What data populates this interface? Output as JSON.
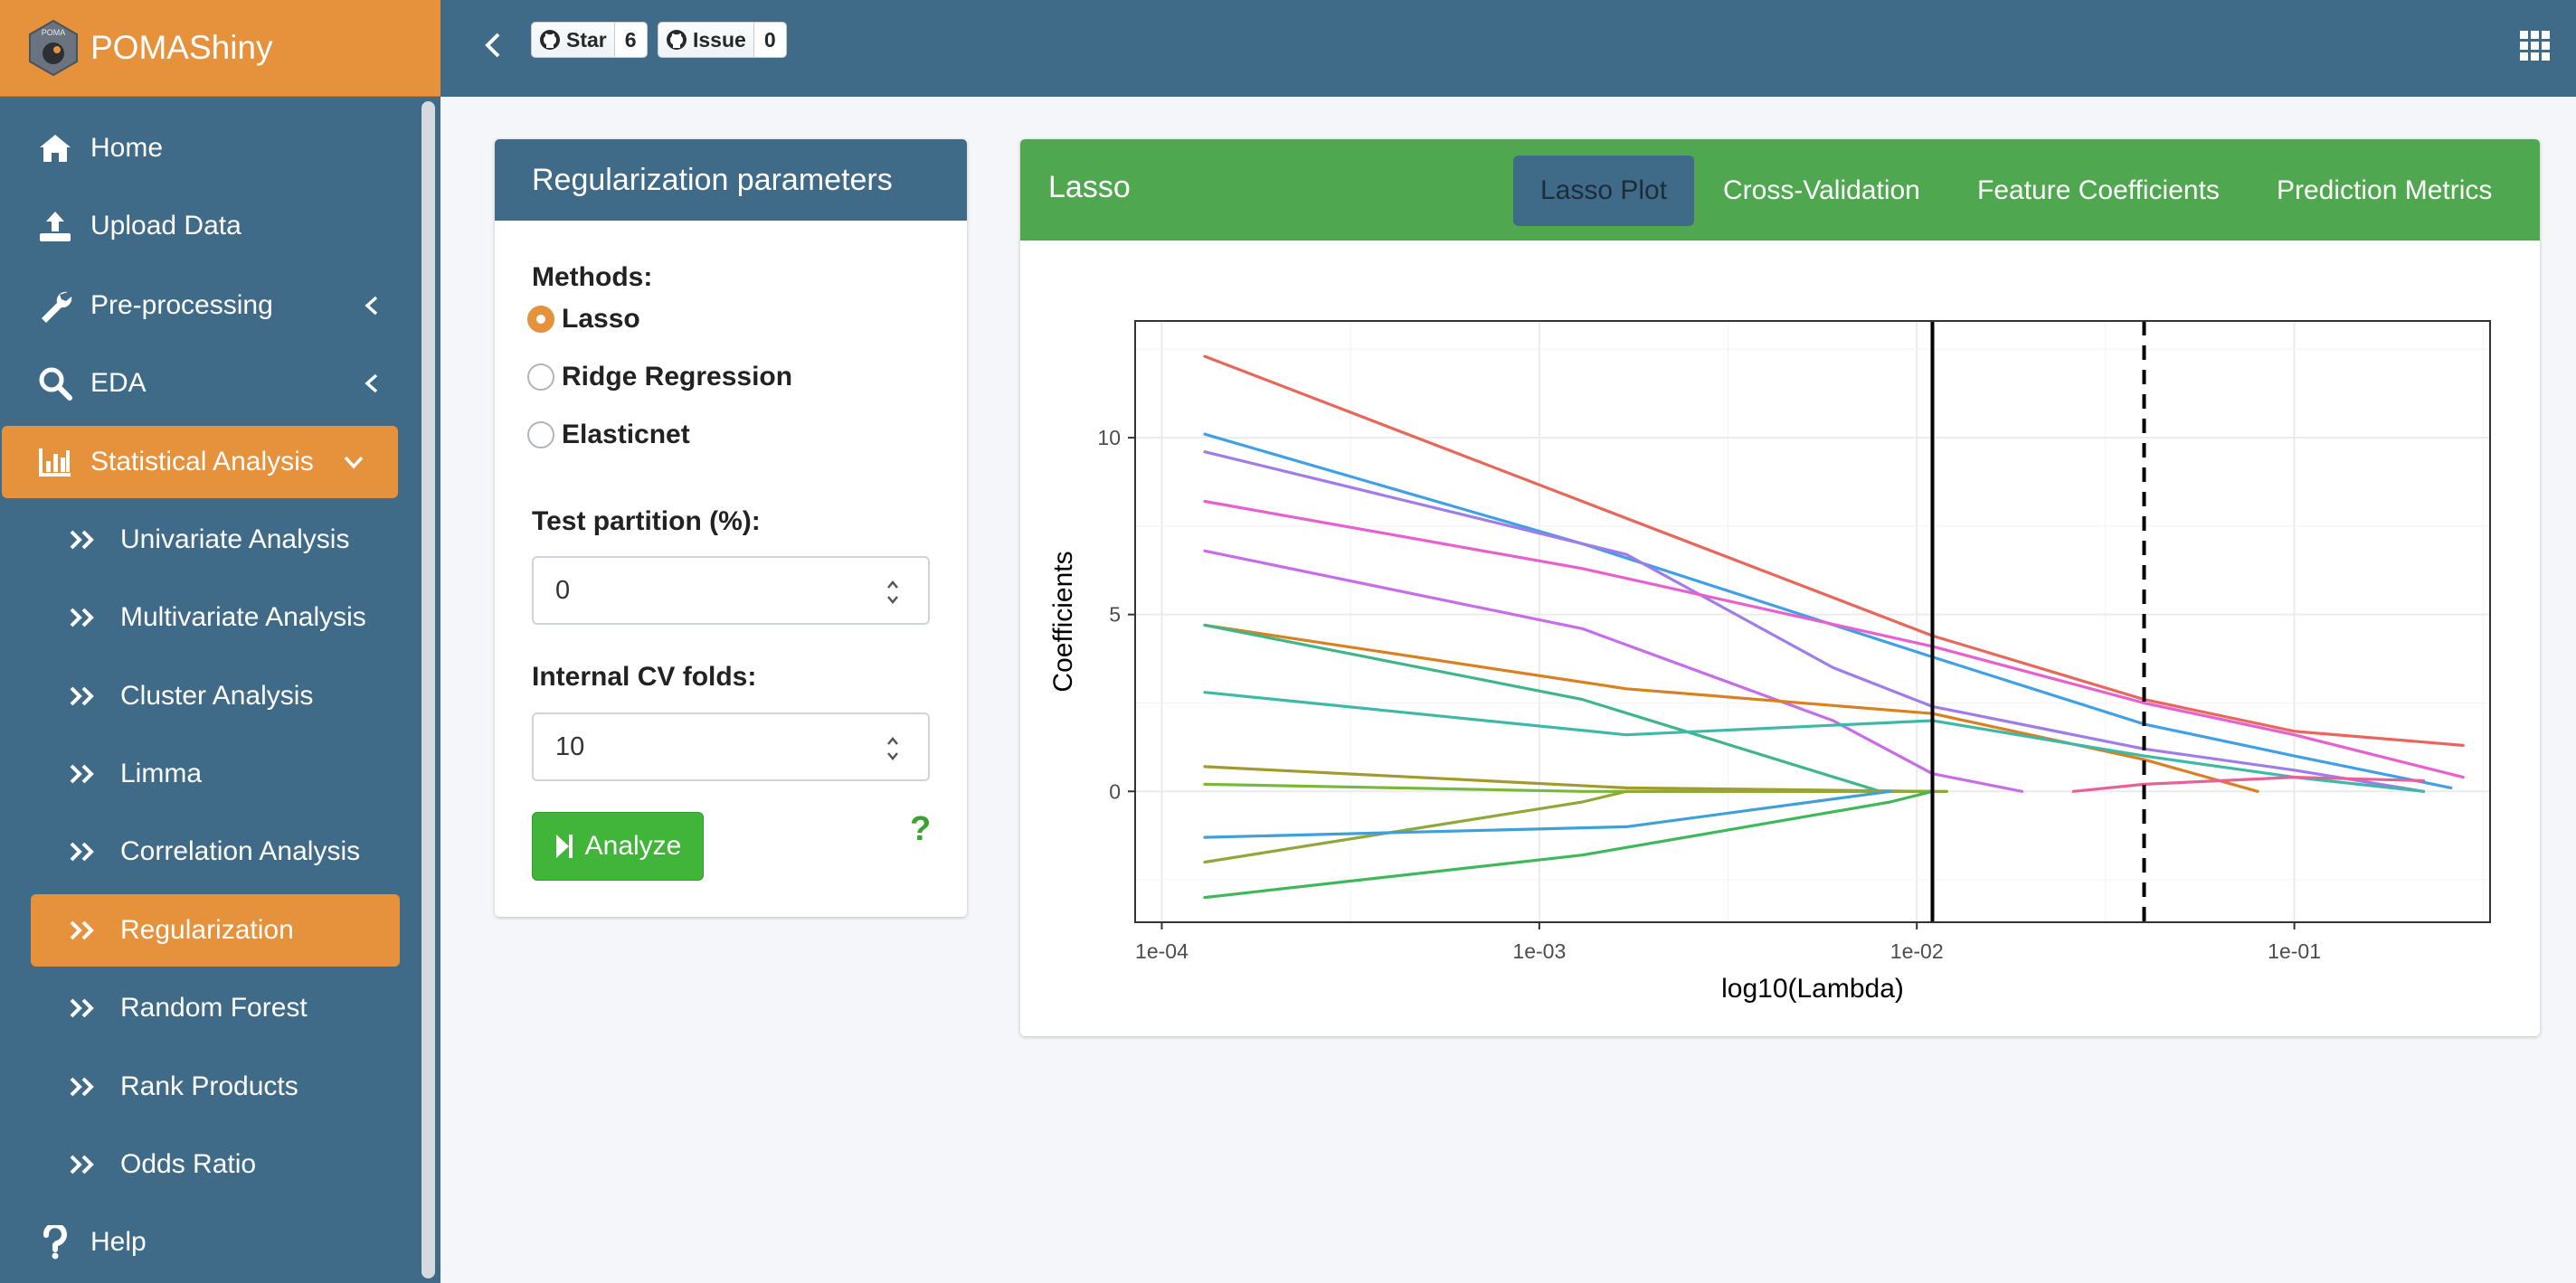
{
  "app": {
    "name": "POMAShiny",
    "logo_text": "POMA",
    "accent_color": "#e6913c",
    "primary_color": "#3f6b88"
  },
  "sidebar": {
    "items": [
      {
        "label": "Home",
        "icon": "home-icon"
      },
      {
        "label": "Upload Data",
        "icon": "upload-icon"
      },
      {
        "label": "Pre-processing",
        "icon": "wrench-icon"
      },
      {
        "label": "EDA",
        "icon": "search-icon"
      },
      {
        "label": "Statistical Analysis",
        "icon": "bar-chart-icon"
      }
    ],
    "sub_items": [
      {
        "label": "Univariate Analysis"
      },
      {
        "label": "Multivariate Analysis"
      },
      {
        "label": "Cluster Analysis"
      },
      {
        "label": "Limma"
      },
      {
        "label": "Correlation Analysis"
      },
      {
        "label": "Regularization"
      },
      {
        "label": "Random Forest"
      },
      {
        "label": "Rank Products"
      },
      {
        "label": "Odds Ratio"
      }
    ],
    "help_label": "Help",
    "active_sub_item": "Regularization"
  },
  "header": {
    "star_label": "Star",
    "star_count": "6",
    "issue_label": "Issue",
    "issue_count": "0"
  },
  "params_panel": {
    "title": "Regularization parameters",
    "methods_label": "Methods:",
    "methods": [
      {
        "label": "Lasso",
        "checked": true
      },
      {
        "label": "Ridge Regression",
        "checked": false
      },
      {
        "label": "Elasticnet",
        "checked": false
      }
    ],
    "test_partition_label": "Test partition (%):",
    "test_partition_value": "0",
    "cv_folds_label": "Internal CV folds:",
    "cv_folds_value": "10",
    "analyze_label": "Analyze",
    "help_label": "?"
  },
  "results_card": {
    "title": "Lasso",
    "tabs": [
      {
        "label": "Lasso Plot",
        "active": true
      },
      {
        "label": "Cross-Validation",
        "active": false
      },
      {
        "label": "Feature Coefficients",
        "active": false
      },
      {
        "label": "Prediction Metrics",
        "active": false
      }
    ]
  },
  "chart_data": {
    "type": "line",
    "xlabel": "log10(Lambda)",
    "ylabel": "Coefficients",
    "x_scale": "log10",
    "xlim": [
      8.5e-05,
      0.33
    ],
    "ylim": [
      -3.7,
      13.3
    ],
    "x_ticks": [
      {
        "value": 0.0001,
        "label": "1e-04"
      },
      {
        "value": 0.001,
        "label": "1e-03"
      },
      {
        "value": 0.01,
        "label": "1e-02"
      },
      {
        "value": 0.1,
        "label": "1e-01"
      }
    ],
    "y_ticks": [
      {
        "value": 0,
        "label": "0"
      },
      {
        "value": 5,
        "label": "5"
      },
      {
        "value": 10,
        "label": "10"
      }
    ],
    "grid": true,
    "vlines": [
      {
        "x": 0.011,
        "style": "solid"
      },
      {
        "x": 0.04,
        "style": "dashed"
      }
    ],
    "series": [
      {
        "color": "#e8675b",
        "points": [
          [
            0.00013,
            12.3
          ],
          [
            0.0013,
            8.2
          ],
          [
            0.011,
            4.4
          ],
          [
            0.04,
            2.6
          ],
          [
            0.1,
            1.7
          ],
          [
            0.28,
            1.3
          ]
        ]
      },
      {
        "color": "#3fa0e8",
        "points": [
          [
            0.00013,
            10.1
          ],
          [
            0.0013,
            7.0
          ],
          [
            0.011,
            3.8
          ],
          [
            0.04,
            1.9
          ],
          [
            0.1,
            1.0
          ],
          [
            0.26,
            0.1
          ]
        ]
      },
      {
        "color": "#a07ce8",
        "points": [
          [
            0.00013,
            9.6
          ],
          [
            0.0017,
            6.7
          ],
          [
            0.006,
            3.5
          ],
          [
            0.011,
            2.4
          ],
          [
            0.04,
            1.2
          ],
          [
            0.1,
            0.6
          ],
          [
            0.22,
            0.0
          ]
        ]
      },
      {
        "color": "#e85fd0",
        "points": [
          [
            0.00013,
            8.2
          ],
          [
            0.0013,
            6.3
          ],
          [
            0.011,
            4.1
          ],
          [
            0.04,
            2.5
          ],
          [
            0.1,
            1.6
          ],
          [
            0.28,
            0.4
          ]
        ]
      },
      {
        "color": "#c86de8",
        "points": [
          [
            0.00013,
            6.8
          ],
          [
            0.0013,
            4.6
          ],
          [
            0.006,
            2.0
          ],
          [
            0.011,
            0.5
          ],
          [
            0.019,
            0.0
          ]
        ]
      },
      {
        "color": "#d98020",
        "points": [
          [
            0.00013,
            4.7
          ],
          [
            0.0017,
            2.9
          ],
          [
            0.011,
            2.2
          ],
          [
            0.04,
            0.9
          ],
          [
            0.08,
            0.0
          ]
        ]
      },
      {
        "color": "#3fb68a",
        "points": [
          [
            0.00013,
            4.7
          ],
          [
            0.0013,
            2.6
          ],
          [
            0.008,
            0.0
          ]
        ]
      },
      {
        "color": "#3fb8a8",
        "points": [
          [
            0.00013,
            2.8
          ],
          [
            0.0017,
            1.6
          ],
          [
            0.011,
            2.0
          ],
          [
            0.04,
            1.0
          ],
          [
            0.1,
            0.4
          ],
          [
            0.22,
            0.0
          ]
        ]
      },
      {
        "color": "#a29a2c",
        "points": [
          [
            0.00013,
            0.7
          ],
          [
            0.0017,
            0.1
          ],
          [
            0.011,
            0.0
          ]
        ]
      },
      {
        "color": "#78b83a",
        "points": [
          [
            0.00013,
            0.2
          ],
          [
            0.0013,
            0.0
          ],
          [
            0.012,
            0.0
          ]
        ]
      },
      {
        "color": "#8fa83a",
        "points": [
          [
            0.00013,
            -2.0
          ],
          [
            0.0013,
            -0.3
          ],
          [
            0.0017,
            0.0
          ],
          [
            0.012,
            0.0
          ]
        ]
      },
      {
        "color": "#3f9fd8",
        "points": [
          [
            0.00013,
            -1.3
          ],
          [
            0.0017,
            -1.0
          ],
          [
            0.0085,
            0.0
          ]
        ]
      },
      {
        "color": "#3fb85a",
        "points": [
          [
            0.00013,
            -3.0
          ],
          [
            0.0013,
            -1.8
          ],
          [
            0.0085,
            -0.3
          ],
          [
            0.011,
            0.0
          ]
        ]
      },
      {
        "color": "#e8609a",
        "points": [
          [
            0.026,
            0.0
          ],
          [
            0.04,
            0.2
          ],
          [
            0.1,
            0.4
          ],
          [
            0.22,
            0.3
          ]
        ]
      }
    ]
  }
}
